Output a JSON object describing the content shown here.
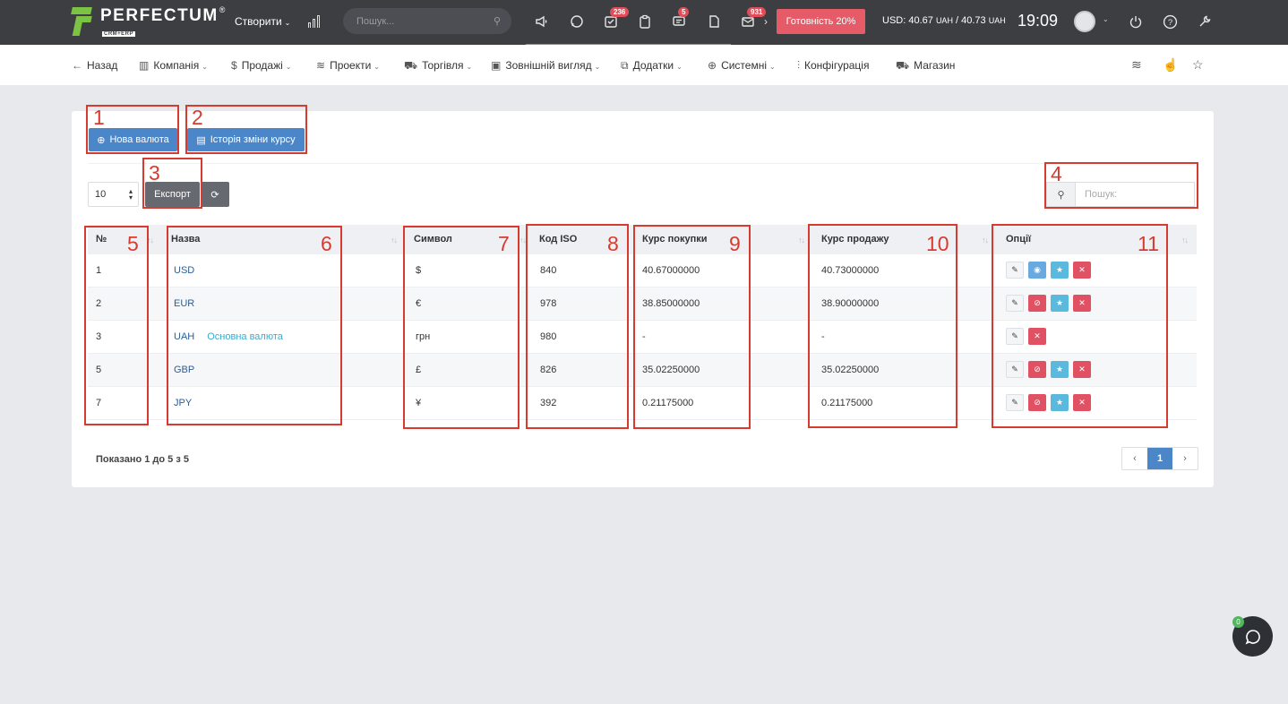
{
  "app": {
    "logo_text": "PERFECTUM",
    "logo_sub": "CRM+ERP",
    "logo_reg": "®"
  },
  "topbar": {
    "create_label": "Створити",
    "search_placeholder": "Пошук...",
    "badges": {
      "tasks": "236",
      "messages": "5",
      "mail": "931"
    },
    "ready_label": "Готовність 20%",
    "rate": {
      "prefix": "USD: 40.67",
      "unit1": "UAH",
      "sep": " / 40.73",
      "unit2": "UAH"
    },
    "clock": "19:09"
  },
  "nav": {
    "back": "Назад",
    "company": "Компанія",
    "sales": "Продажі",
    "projects": "Проекти",
    "trade": "Торгівля",
    "appearance": "Зовнішній вигляд",
    "addons": "Додатки",
    "system": "Системні",
    "config": "Конфігурація",
    "shop": "Магазин"
  },
  "toolbar": {
    "new_currency": "Нова валюта",
    "history": "Історія зміни курсу",
    "page_length": "10",
    "export": "Експорт",
    "search_placeholder": "Пошук:"
  },
  "table": {
    "headers": [
      "№",
      "Назва",
      "Символ",
      "Код ISO",
      "Курс покупки",
      "Курс продажу",
      "Опції"
    ],
    "main_currency_label": "Основна валюта",
    "rows": [
      {
        "num": "1",
        "name": "USD",
        "symbol": "$",
        "iso": "840",
        "buy": "40.67000000",
        "sell": "40.73000000"
      },
      {
        "num": "2",
        "name": "EUR",
        "symbol": "€",
        "iso": "978",
        "buy": "38.85000000",
        "sell": "38.90000000"
      },
      {
        "num": "3",
        "name": "UAH",
        "symbol": "грн",
        "iso": "980",
        "buy": "-",
        "sell": "-"
      },
      {
        "num": "5",
        "name": "GBP",
        "symbol": "£",
        "iso": "826",
        "buy": "35.02250000",
        "sell": "35.02250000"
      },
      {
        "num": "7",
        "name": "JPY",
        "symbol": "¥",
        "iso": "392",
        "buy": "0.21175000",
        "sell": "0.21175000"
      }
    ]
  },
  "footer": {
    "info": "Показано 1 до 5 з 5",
    "page": "1"
  },
  "annotations": [
    "1",
    "2",
    "3",
    "4",
    "5",
    "6",
    "7",
    "8",
    "9",
    "10",
    "11"
  ],
  "chat": {
    "badge": "0"
  },
  "colors": {
    "accent": "#4a86c8",
    "danger": "#e05263",
    "annotation": "#d73b30",
    "topbar": "#3d3e42"
  }
}
